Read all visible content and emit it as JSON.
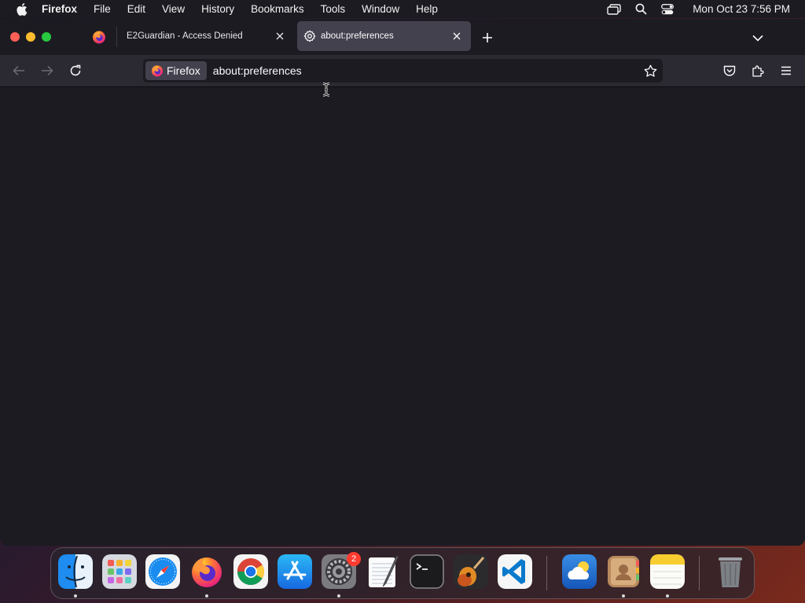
{
  "menubar": {
    "app_name": "Firefox",
    "items": [
      "File",
      "Edit",
      "View",
      "History",
      "Bookmarks",
      "Tools",
      "Window",
      "Help"
    ],
    "clock": "Mon Oct 23  7:56 PM",
    "status_icons": [
      "screen-mirroring-icon",
      "spotlight-search-icon",
      "control-center-icon"
    ]
  },
  "tabs": [
    {
      "title": "E2Guardian - Access Denied",
      "active": false
    },
    {
      "title": "about:preferences",
      "active": true
    }
  ],
  "urlbar": {
    "identity_label": "Firefox",
    "url": "about:preferences"
  },
  "dock": {
    "apps": [
      "Finder",
      "Launchpad",
      "Safari",
      "Firefox",
      "Google Chrome",
      "App Store",
      "System Settings",
      "TextEdit",
      "Terminal",
      "GarageBand",
      "Visual Studio Code",
      "Weather",
      "Contacts",
      "Notes",
      "Trash"
    ],
    "system_settings_badge": "2"
  },
  "colors": {
    "window_bg": "#1c1b22",
    "toolbar_bg": "#2b2a33",
    "active_tab_bg": "#42414d",
    "badge": "#ff3b30"
  }
}
